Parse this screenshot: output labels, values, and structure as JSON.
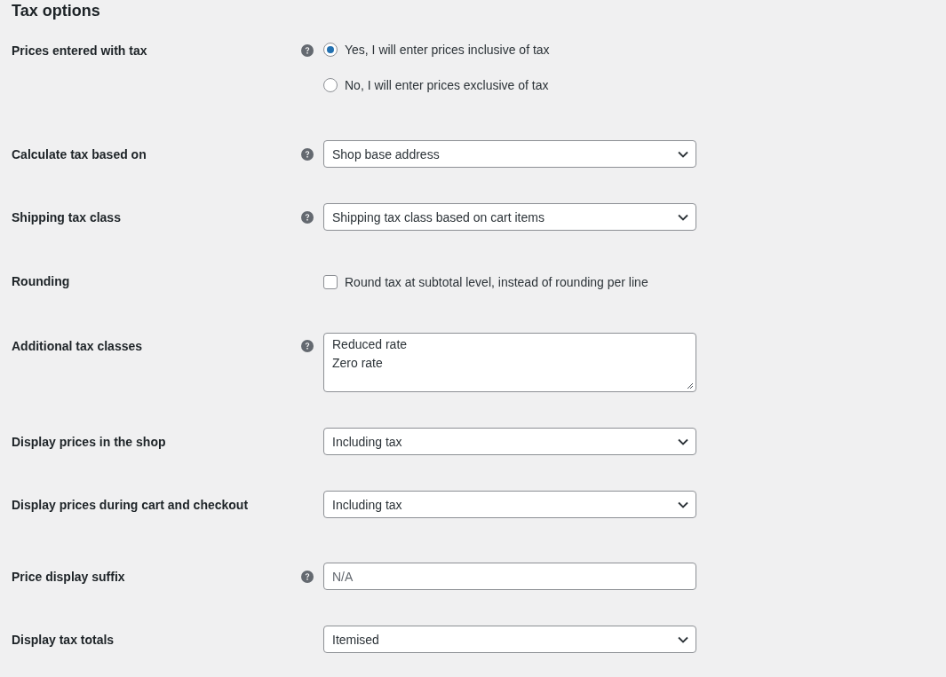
{
  "section_title": "Tax options",
  "settings": [
    {
      "label": "Prices entered with tax",
      "help": true,
      "kind": "radio",
      "options": [
        {
          "label": "Yes, I will enter prices inclusive of tax",
          "selected": true
        },
        {
          "label": "No, I will enter prices exclusive of tax",
          "selected": false
        }
      ]
    },
    {
      "label": "Calculate tax based on",
      "help": true,
      "kind": "select",
      "value": "Shop base address"
    },
    {
      "label": "Shipping tax class",
      "help": true,
      "kind": "select",
      "value": "Shipping tax class based on cart items"
    },
    {
      "label": "Rounding",
      "help": false,
      "kind": "checkbox",
      "checked": false,
      "text": "Round tax at subtotal level, instead of rounding per line"
    },
    {
      "label": "Additional tax classes",
      "help": true,
      "kind": "textarea",
      "lines": [
        "Reduced rate",
        "Zero rate"
      ]
    },
    {
      "label": "Display prices in the shop",
      "help": false,
      "kind": "select",
      "value": "Including tax"
    },
    {
      "label": "Display prices during cart and checkout",
      "help": false,
      "kind": "select",
      "value": "Including tax"
    },
    {
      "label": "Price display suffix",
      "help": true,
      "kind": "text",
      "placeholder": "N/A"
    },
    {
      "label": "Display tax totals",
      "help": false,
      "kind": "select",
      "value": "Itemised"
    }
  ]
}
